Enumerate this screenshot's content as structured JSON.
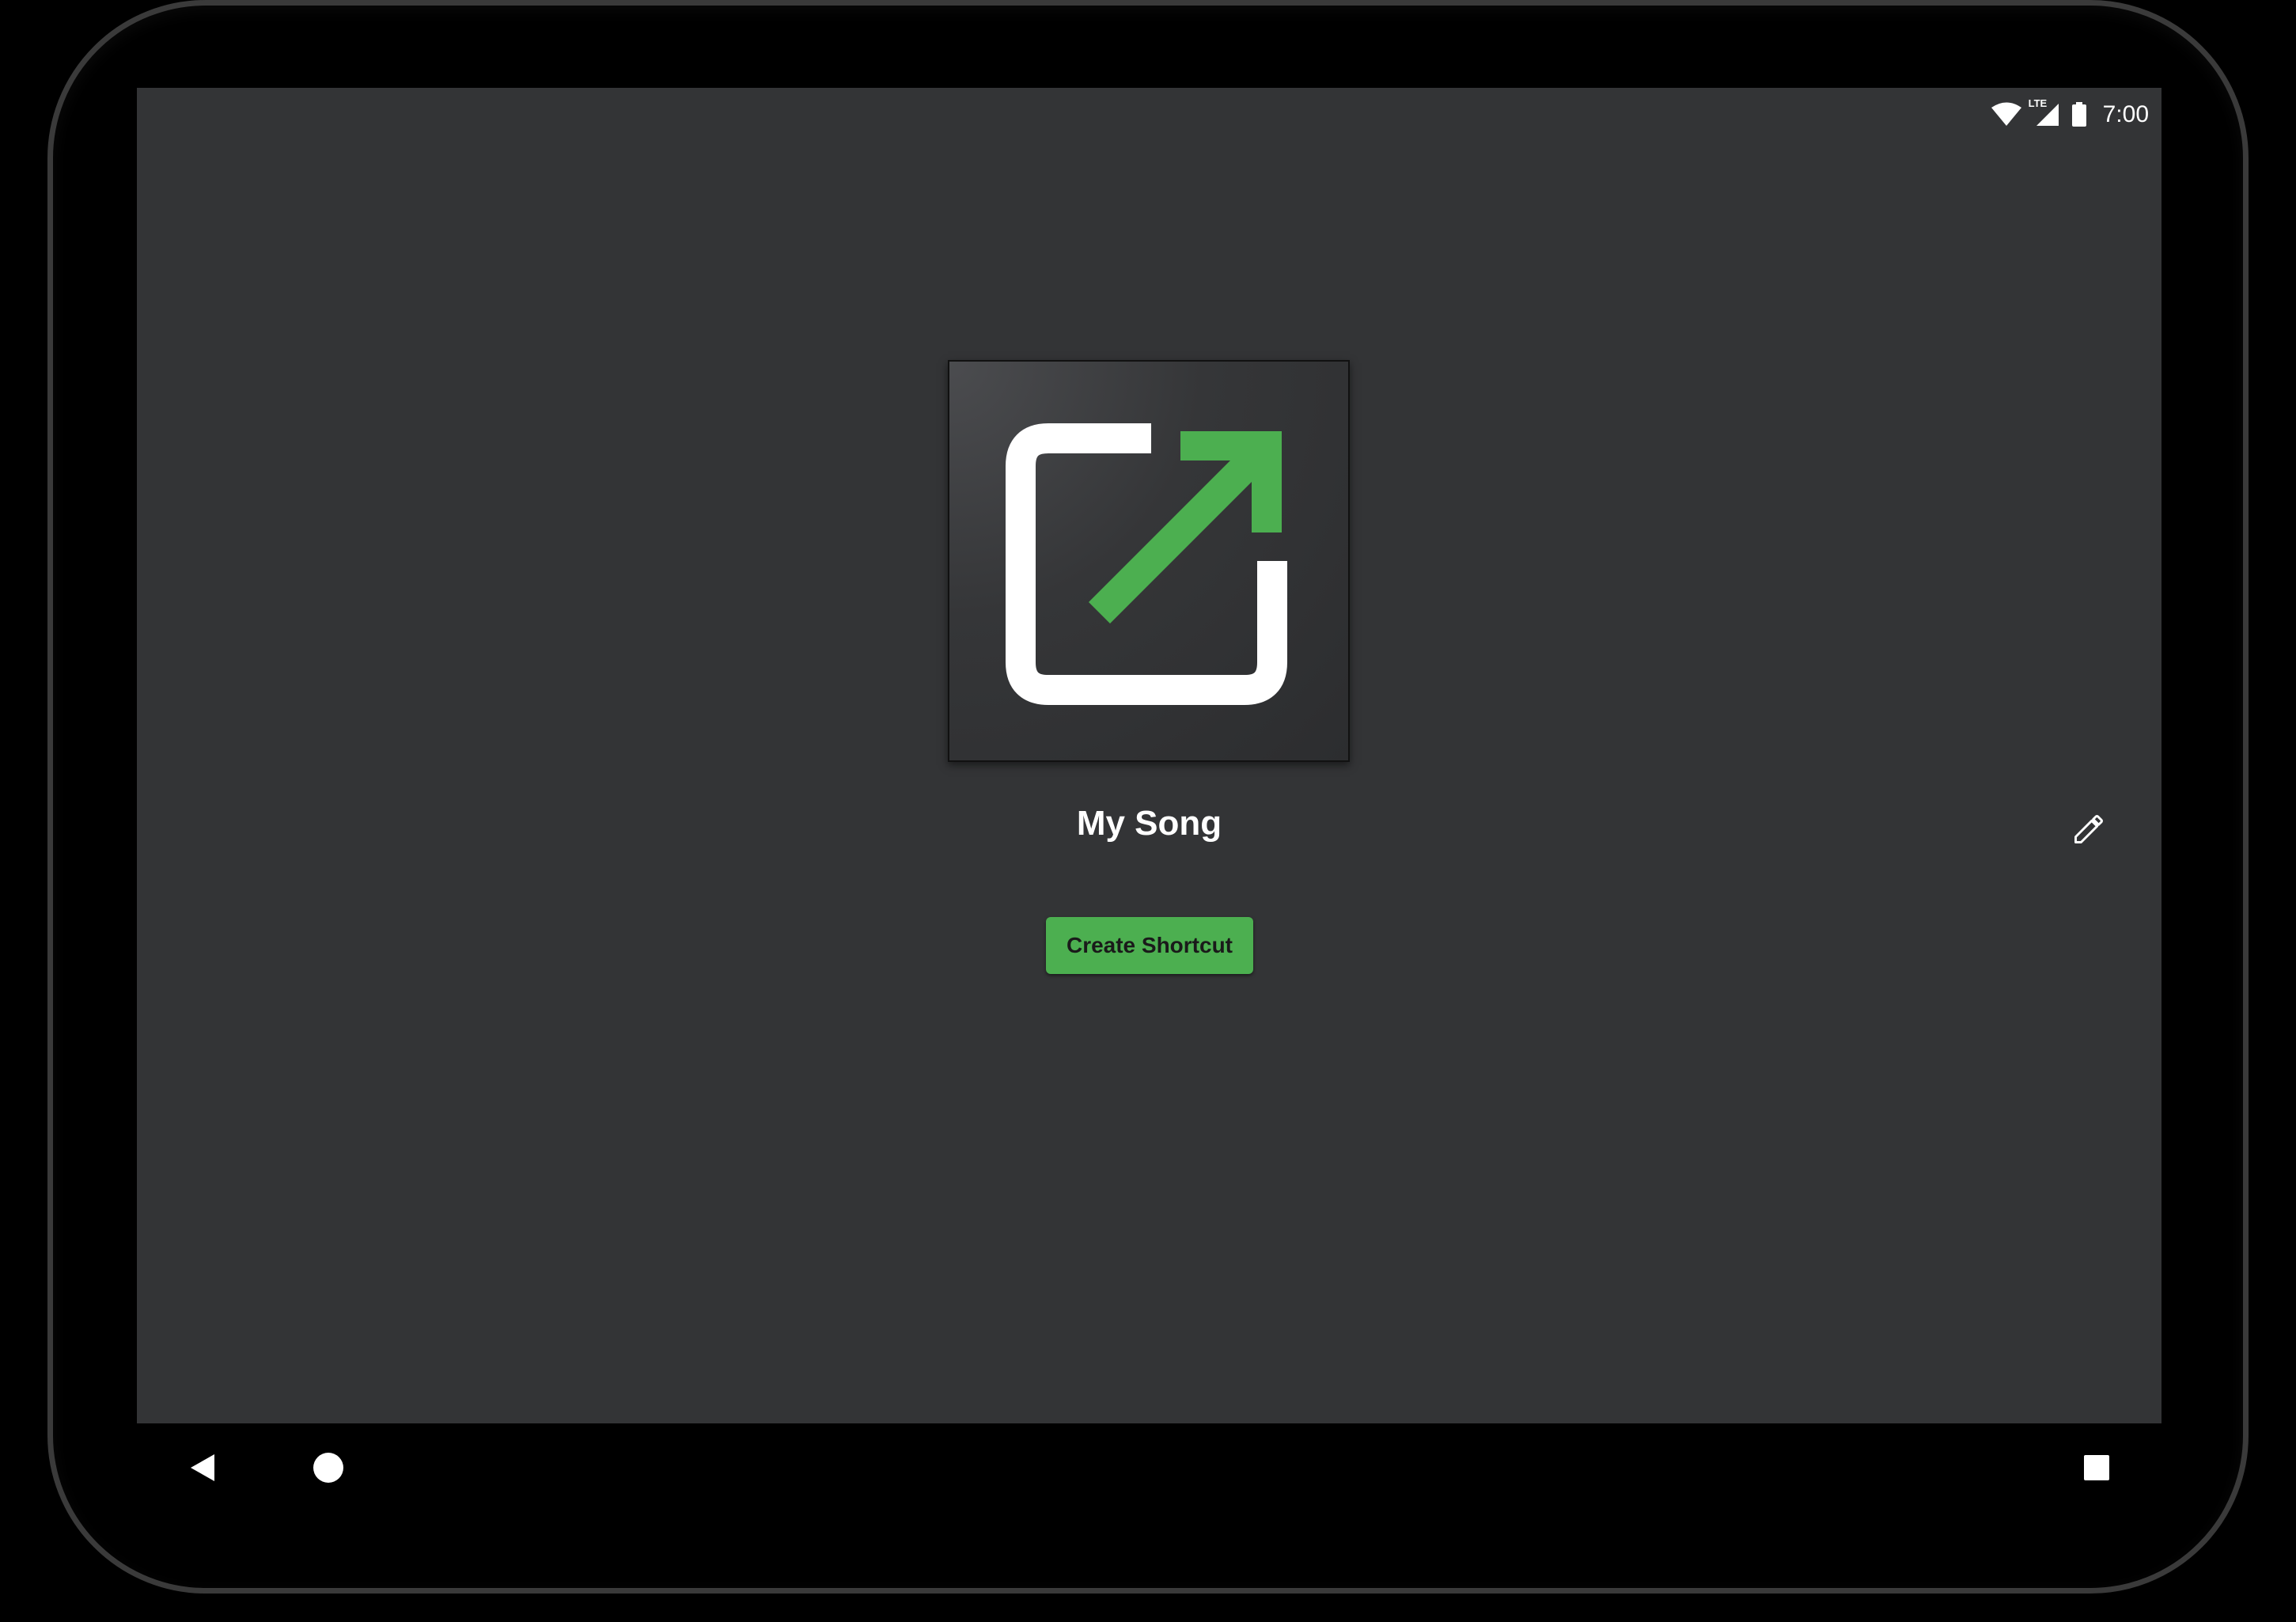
{
  "status_bar": {
    "time": "7:00",
    "icons": [
      "wifi-icon",
      "lte-signal-icon",
      "battery-icon"
    ],
    "network_label": "LTE"
  },
  "shortcut": {
    "icon": "open-in-new-icon",
    "title": "My Song",
    "edit_icon": "pencil-icon",
    "create_label": "Create Shortcut"
  },
  "navigation": {
    "back_icon": "back-triangle-icon",
    "home_icon": "home-circle-icon",
    "recents_icon": "recents-square-icon"
  },
  "colors": {
    "screen_background": "#333436",
    "accent": "#4caf50",
    "icon_white": "#ffffff"
  }
}
